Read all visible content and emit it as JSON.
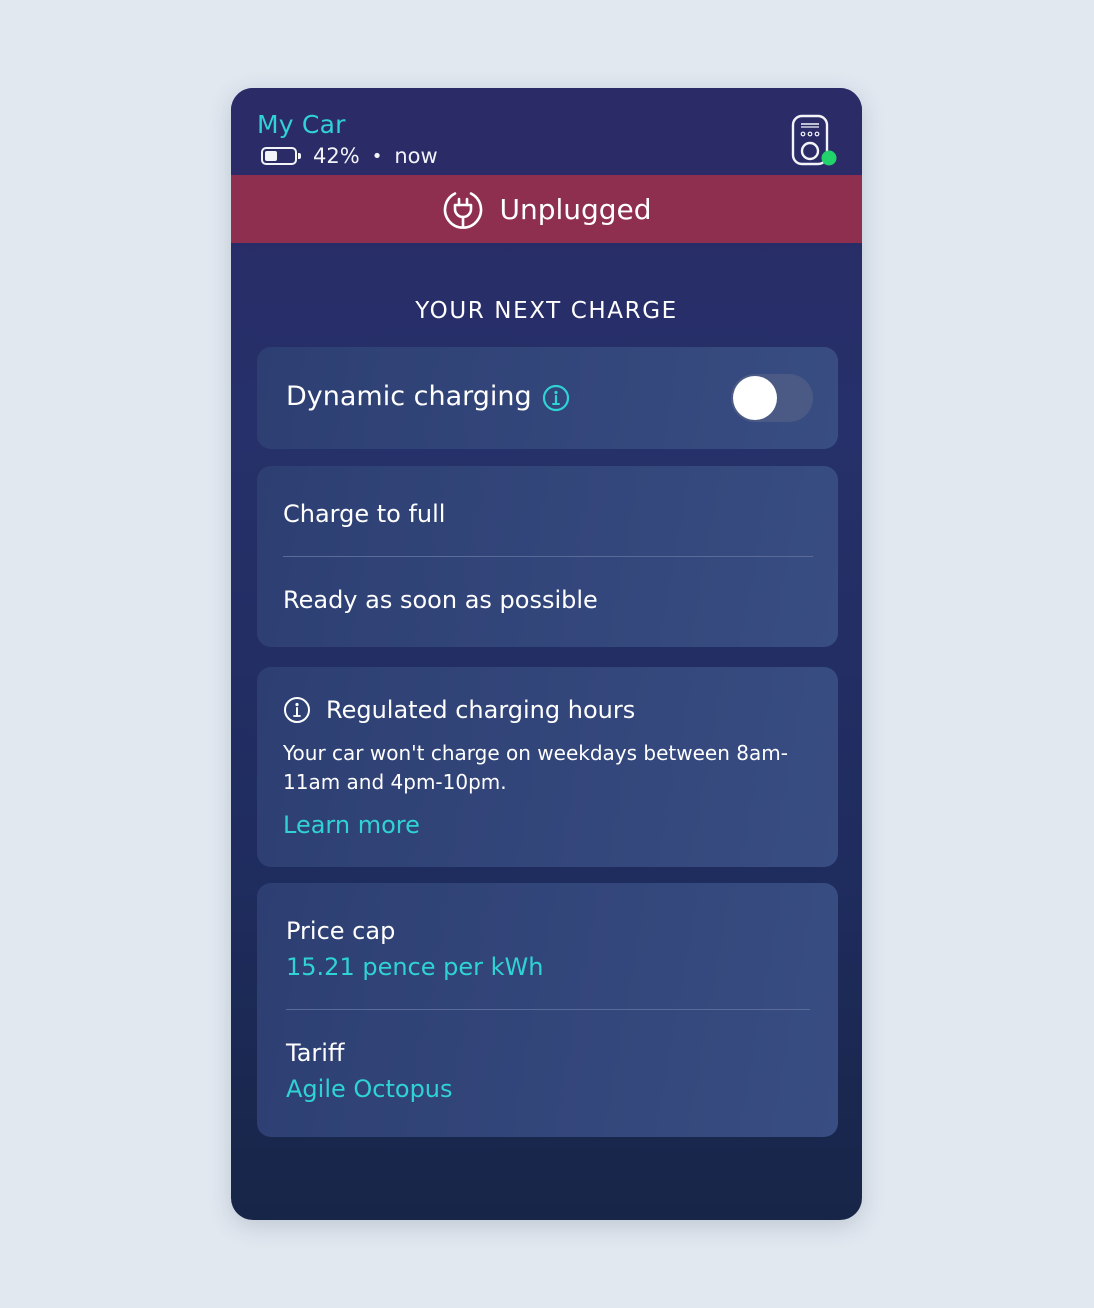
{
  "header": {
    "car_name": "My Car",
    "battery_percent_label": "42%",
    "battery_level": 0.42,
    "separator": "•",
    "updated": "now",
    "status_dot_color": "#22d36b"
  },
  "banner": {
    "label": "Unplugged",
    "color": "#8e2f4f"
  },
  "section": {
    "title": "YOUR NEXT CHARGE"
  },
  "dynamic_charging": {
    "label": "Dynamic charging",
    "enabled": false
  },
  "charge_plan": {
    "target": "Charge to full",
    "ready": "Ready as soon as possible"
  },
  "regulated": {
    "title": "Regulated charging hours",
    "body": "Your car won't charge on weekdays between 8am-11am and 4pm-10pm.",
    "link": "Learn more"
  },
  "pricing": {
    "price_cap_label": "Price cap",
    "price_cap_value": "15.21 pence per kWh",
    "tariff_label": "Tariff",
    "tariff_value": "Agile Octopus"
  },
  "colors": {
    "accent": "#2fd3d6",
    "background": "#e1e8f0"
  }
}
